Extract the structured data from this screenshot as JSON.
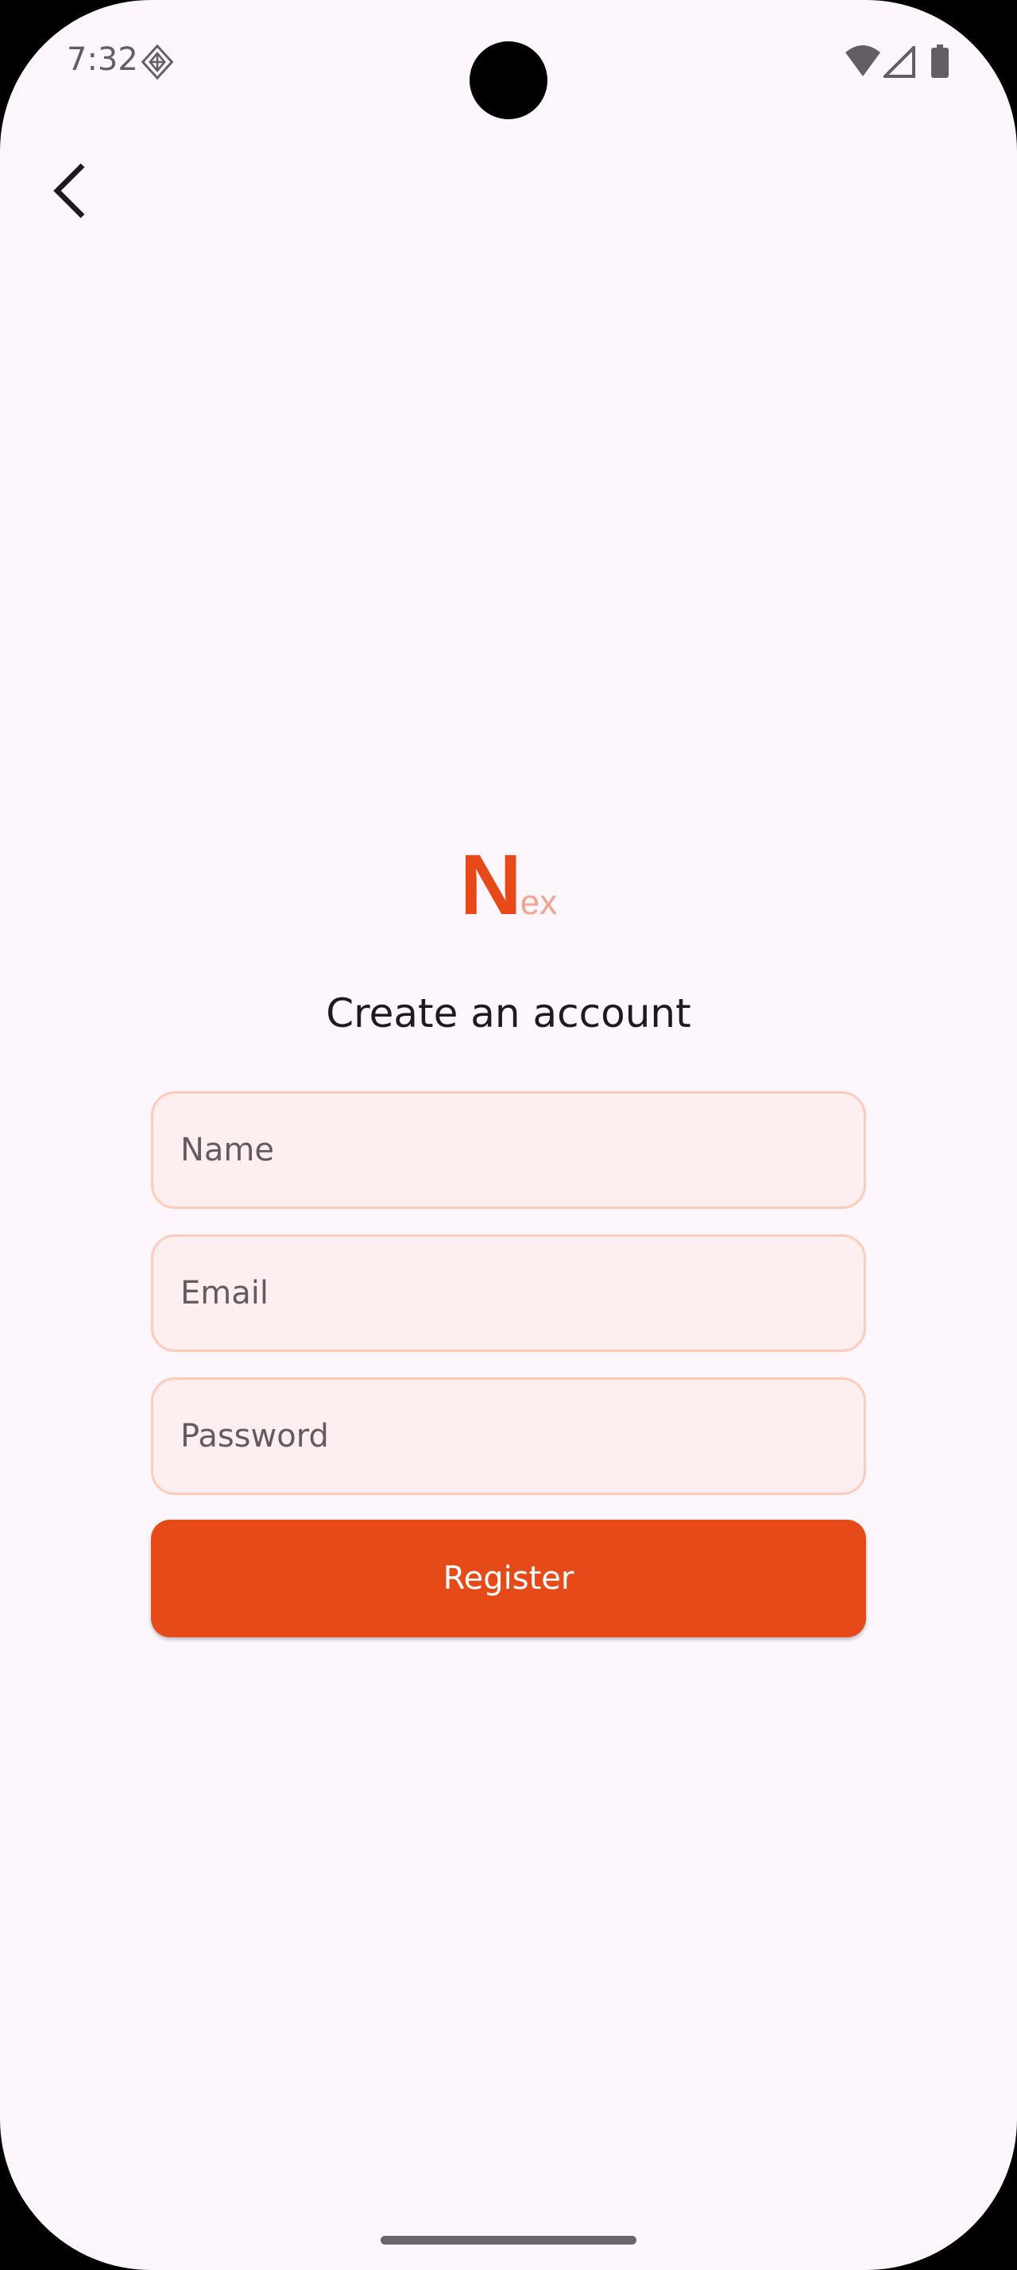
{
  "status_bar": {
    "time": "7:32",
    "icons": [
      "notification-diamond-icon",
      "wifi-icon",
      "signal-icon",
      "battery-icon"
    ]
  },
  "nav": {
    "back_icon": "chevron-left-icon"
  },
  "logo": {
    "big": "N",
    "small": "ex"
  },
  "title": "Create an account",
  "form": {
    "name_placeholder": "Name",
    "email_placeholder": "Email",
    "password_placeholder": "Password",
    "register_label": "Register"
  },
  "colors": {
    "accent": "#e64a19",
    "field_border": "#ffccbc",
    "field_bg": "#fdeef0",
    "background": "#fdf7fd"
  }
}
